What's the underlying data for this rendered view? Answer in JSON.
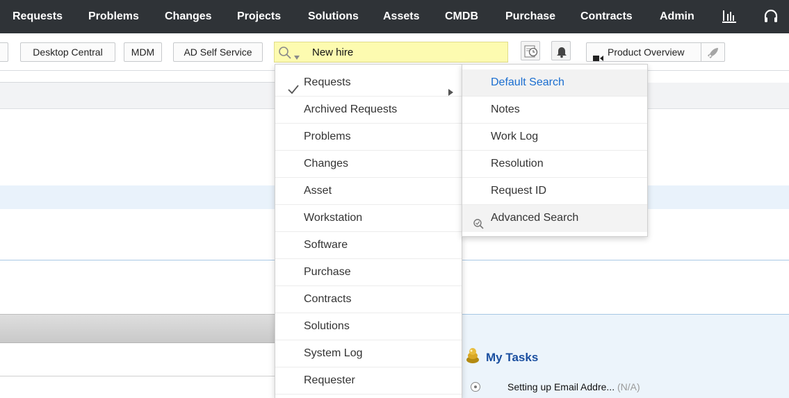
{
  "topnav": {
    "items": [
      "Requests",
      "Problems",
      "Changes",
      "Projects",
      "Solutions",
      "Assets",
      "CMDB",
      "Purchase",
      "Contracts",
      "Admin"
    ],
    "reports_icon": "bar-chart-icon",
    "support_icon": "headset-icon"
  },
  "toolbar": {
    "buttons": [
      "Desktop Central",
      "MDM",
      "AD Self Service"
    ],
    "search": {
      "value": "New hire",
      "icon": "search-icon"
    },
    "history_icon": "clock-history-icon",
    "bell_icon": "bell-icon",
    "product_overview": "Product Overview",
    "product_overview_icon": "video-icon",
    "rocket_icon": "rocket-icon"
  },
  "search_menu": {
    "modules": [
      "Requests",
      "Archived Requests",
      "Problems",
      "Changes",
      "Asset",
      "Workstation",
      "Software",
      "Purchase",
      "Contracts",
      "Solutions",
      "System Log",
      "Requester"
    ],
    "selected": "Requests",
    "submenu": [
      "Default Search",
      "Notes",
      "Work Log",
      "Resolution",
      "Request ID",
      "Advanced Search"
    ],
    "submenu_active": "Default Search"
  },
  "tasks": {
    "title": "My Tasks",
    "items": [
      {
        "text": "Setting up Email Addre...",
        "note": "(N/A)"
      }
    ]
  },
  "colors": {
    "nav_bg": "#2f3337",
    "search_bg": "#fdfbb0",
    "link_blue": "#1a6ed0",
    "tasks_title": "#1b4fa0"
  }
}
